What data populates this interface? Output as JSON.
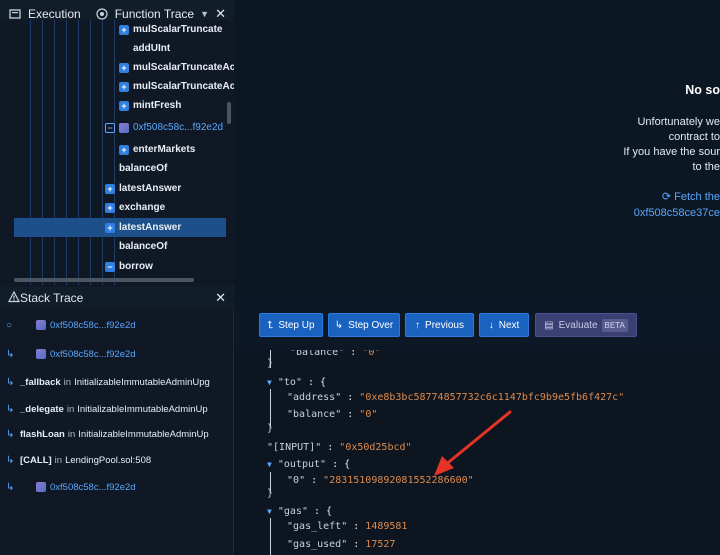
{
  "tabs": [
    {
      "label": "Execution",
      "icon": "execution-icon"
    },
    {
      "label": "Function Trace",
      "icon": "target-icon"
    }
  ],
  "tree": [
    {
      "label": "mulScalarTruncate",
      "plus": true
    },
    {
      "label": "addUInt",
      "plus": false
    },
    {
      "label": "mulScalarTruncateAc",
      "plus": true
    },
    {
      "label": "mulScalarTruncateAc",
      "plus": true
    },
    {
      "label": "mintFresh",
      "plus": true
    },
    {
      "label": "0xf508c58c...f92e2d",
      "minus": true,
      "contract": true
    },
    {
      "label": "enterMarkets",
      "plus": true
    },
    {
      "label": "balanceOf",
      "plus": false
    },
    {
      "label": "latestAnswer",
      "plus": true
    },
    {
      "label": "exchange",
      "plus": true
    },
    {
      "label": "latestAnswer",
      "plus": true,
      "selected": true
    },
    {
      "label": "balanceOf",
      "plus": false
    },
    {
      "label": "borrow",
      "minus": true
    }
  ],
  "stack": {
    "title": "Stack Trace",
    "rows": [
      {
        "fn": "",
        "addr": "0xf508c58c...f92e2d",
        "contract": true,
        "icon": "circle-icon"
      },
      {
        "fn": "",
        "addr": "0xf508c58c...f92e2d",
        "contract": true,
        "icon": "return-arrow-icon"
      },
      {
        "fn": "_fallback",
        "in": "in",
        "ctx": "InitializableImmutableAdminUpg",
        "icon": "return-arrow-icon"
      },
      {
        "fn": "_delegate",
        "in": "in",
        "ctx": "InitializableImmutableAdminUp",
        "icon": "return-arrow-icon"
      },
      {
        "fn": "flashLoan",
        "in": "in",
        "ctx": "InitializableImmutableAdminUp",
        "icon": "return-arrow-icon"
      },
      {
        "fn": "[CALL]",
        "in": "in",
        "ctx": "LendingPool.sol:508",
        "icon": "return-arrow-icon"
      },
      {
        "fn": "",
        "addr": "0xf508c58c...f92e2d",
        "contract": true,
        "icon": "return-arrow-icon"
      }
    ]
  },
  "message": {
    "title": "No so",
    "line1": "Unfortunately we",
    "line2": "contract to",
    "line3": "If you have the sour",
    "line4": "to the",
    "fetch": "Fetch the",
    "address": "0xf508c58ce37ce"
  },
  "toolbar": {
    "step_up": "Step Up",
    "step_over": "Step Over",
    "previous": "Previous",
    "next": "Next",
    "evaluate": "Evaluate",
    "beta": "BETA"
  },
  "code": {
    "balance_top_key": "balance",
    "balance_top_val": "0",
    "to_key": "to",
    "address_key": "address",
    "address_val": "0xe8b3bc58774857732c6c1147bfc9b9e5fb6f427c",
    "balance_key": "balance",
    "balance_val": "0",
    "input_key": "[INPUT]",
    "input_val": "0x50d25bcd",
    "output_key": "output",
    "output0_key": "0",
    "output0_val": "28315109892081552286600",
    "gas_key": "gas",
    "gas_left_key": "gas_left",
    "gas_left_val": "1489581",
    "gas_used_key": "gas_used",
    "gas_used_val": "17527"
  },
  "colors": {
    "accent": "#1a62c0",
    "selected": "#1d4f8a",
    "string": "#e08a4a",
    "arrow": "#e53326"
  }
}
